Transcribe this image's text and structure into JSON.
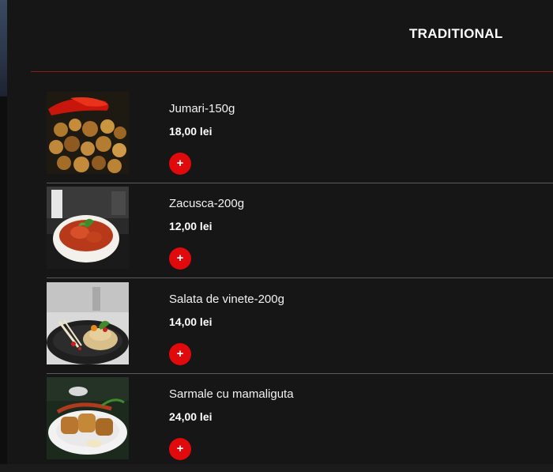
{
  "header": {
    "title": "TRADITIONAL"
  },
  "colors": {
    "accent": "#e0090b",
    "divider_red": "#8b1a1a",
    "background": "#161616"
  },
  "menu": {
    "items": [
      {
        "name": "Jumari-150g",
        "price": "18,00 lei",
        "add_label": "+",
        "image": "jumari-photo"
      },
      {
        "name": "Zacusca-200g",
        "price": "12,00 lei",
        "add_label": "+",
        "image": "zacusca-photo"
      },
      {
        "name": "Salata de vinete-200g",
        "price": "14,00 lei",
        "add_label": "+",
        "image": "salata-de-vinete-photo"
      },
      {
        "name": "Sarmale cu mamaliguta",
        "price": "24,00 lei",
        "add_label": "+",
        "image": "sarmale-photo"
      }
    ]
  }
}
